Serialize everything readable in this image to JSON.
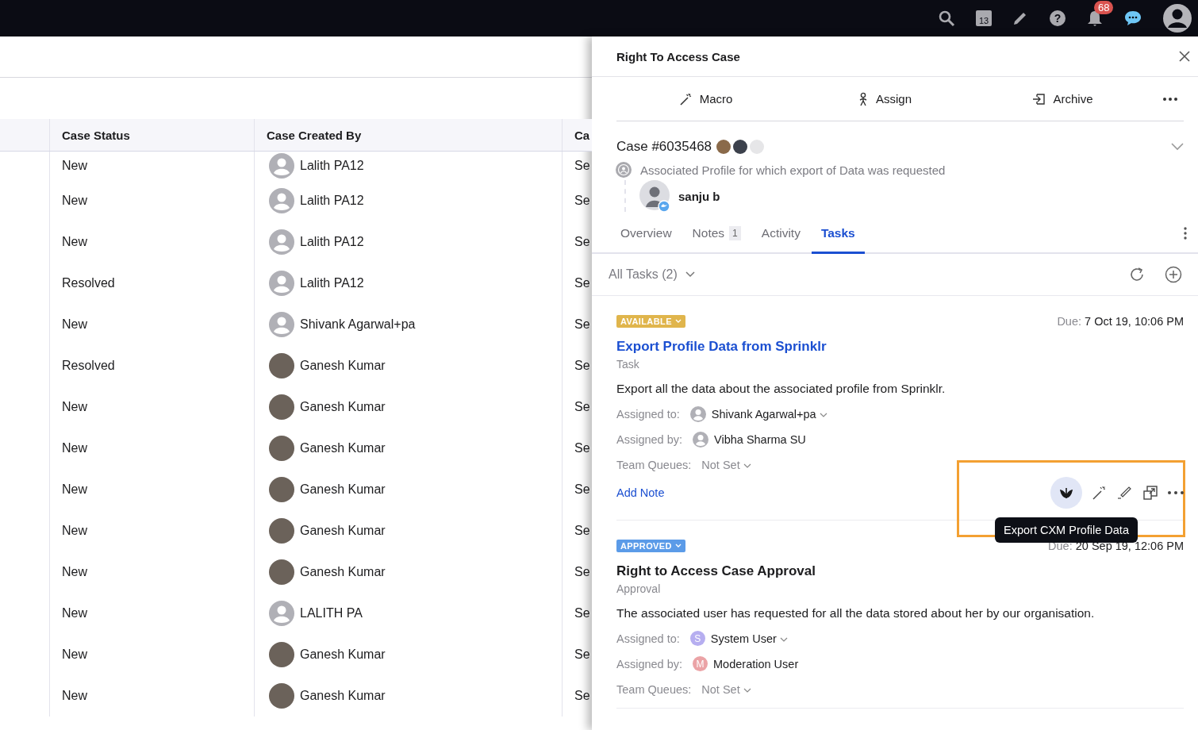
{
  "top_bar": {
    "calendar_day": "13",
    "help_mark": "?",
    "notification_count": "68"
  },
  "table": {
    "columns": [
      "Case Status",
      "Case Created By",
      "Ca"
    ],
    "rows": [
      {
        "status": "New",
        "created_by": "Lalith PA12",
        "kind": "placeholder",
        "column_3": "Se"
      },
      {
        "status": "New",
        "created_by": "Lalith PA12",
        "kind": "placeholder",
        "column_3": "Se"
      },
      {
        "status": "New",
        "created_by": "Lalith PA12",
        "kind": "placeholder",
        "column_3": "Se"
      },
      {
        "status": "Resolved",
        "created_by": "Lalith PA12",
        "kind": "placeholder",
        "column_3": "Se"
      },
      {
        "status": "New",
        "created_by": "Shivank Agarwal+pa",
        "kind": "placeholder",
        "column_3": "Se"
      },
      {
        "status": "Resolved",
        "created_by": "Ganesh Kumar",
        "kind": "photo",
        "column_3": "Se"
      },
      {
        "status": "New",
        "created_by": "Ganesh Kumar",
        "kind": "photo",
        "column_3": "Se"
      },
      {
        "status": "New",
        "created_by": "Ganesh Kumar",
        "kind": "photo",
        "column_3": "Se"
      },
      {
        "status": "New",
        "created_by": "Ganesh Kumar",
        "kind": "photo",
        "column_3": "Se"
      },
      {
        "status": "New",
        "created_by": "Ganesh Kumar",
        "kind": "photo",
        "column_3": "Se"
      },
      {
        "status": "New",
        "created_by": "Ganesh Kumar",
        "kind": "photo",
        "column_3": "Se"
      },
      {
        "status": "New",
        "created_by": "LALITH PA",
        "kind": "placeholder",
        "column_3": "Se"
      },
      {
        "status": "New",
        "created_by": "Ganesh Kumar",
        "kind": "photo",
        "column_3": "Se"
      },
      {
        "status": "New",
        "created_by": "Ganesh Kumar",
        "kind": "photo",
        "column_3": "Se"
      }
    ]
  },
  "panel": {
    "title": "Right To Access Case",
    "actions": [
      {
        "kind": "macro",
        "label": "Macro"
      },
      {
        "kind": "assign",
        "label": "Assign"
      },
      {
        "kind": "archive",
        "label": "Archive"
      }
    ],
    "case": {
      "number": "Case #6035468",
      "description": "Associated Profile for which export of Data was requested",
      "profile_name": "sanju b"
    },
    "tabs": [
      {
        "label": "Overview",
        "selected": false
      },
      {
        "label": "Notes",
        "count": "1",
        "selected": false
      },
      {
        "label": "Activity",
        "selected": false
      },
      {
        "label": "Tasks",
        "selected": true
      }
    ],
    "filter": "All Tasks (2)",
    "tasks": [
      {
        "status": "AVAILABLE",
        "color": "#e0b54c",
        "due_label": "Due:",
        "due": "7 Oct 19, 10:06 PM",
        "title": "Export Profile Data from Sprinklr",
        "hovered": true,
        "type": "Task",
        "description": "Export all the data about the associated profile from Sprinklr.",
        "fields": [
          {
            "label": "Assigned to:",
            "value": "Shivank Agarwal+pa",
            "kind": "placeholder",
            "dropdown": true
          },
          {
            "label": "Assigned by:",
            "value": "Vibha Sharma SU",
            "kind": "placeholder",
            "dropdown": false
          },
          {
            "label": "Team Queues:",
            "value": "Not Set",
            "kind": "none",
            "dropdown": true,
            "muted": true
          }
        ],
        "add_note": "Add Note",
        "tooltip": "Export CXM Profile Data"
      },
      {
        "status": "APPROVED",
        "color": "#5b9be8",
        "due_label": "Due:",
        "due": "20 Sep 19, 12:06 PM",
        "title": "Right to Access Case Approval",
        "hovered": false,
        "type": "Approval",
        "description": "The associated user has requested for all the data stored about her by our organisation.",
        "fields": [
          {
            "label": "Assigned to:",
            "value": "System User",
            "kind": "letter",
            "letter": "S",
            "color": "#b6aef0",
            "dropdown": true
          },
          {
            "label": "Assigned by:",
            "value": "Moderation User",
            "kind": "letter",
            "letter": "M",
            "color": "#eba3a6",
            "dropdown": false
          },
          {
            "label": "Team Queues:",
            "value": "Not Set",
            "kind": "none",
            "dropdown": true,
            "muted": true
          }
        ]
      }
    ]
  }
}
